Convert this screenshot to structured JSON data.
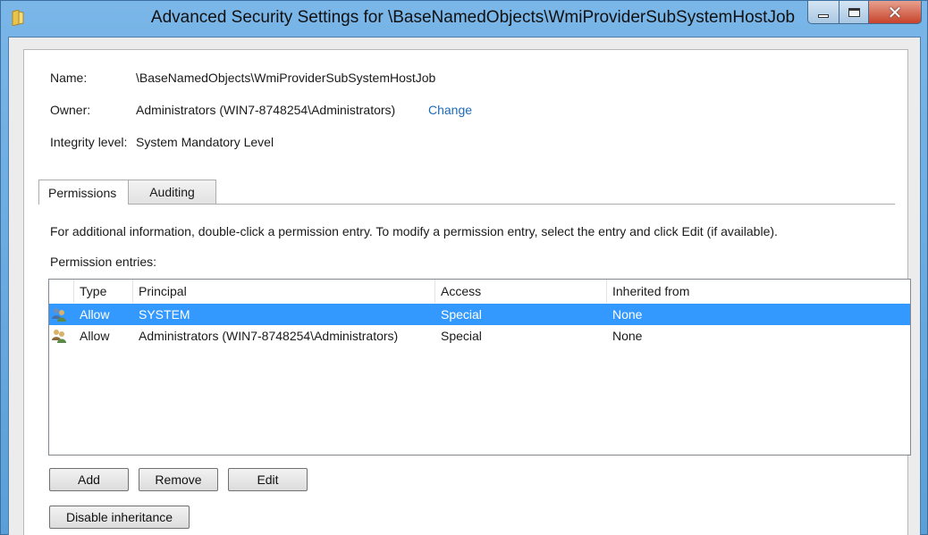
{
  "window": {
    "title": "Advanced Security Settings for \\BaseNamedObjects\\WmiProviderSubSystemHostJob"
  },
  "fields": {
    "name_label": "Name:",
    "name_value": "\\BaseNamedObjects\\WmiProviderSubSystemHostJob",
    "owner_label": "Owner:",
    "owner_value": "Administrators (WIN7-8748254\\Administrators)",
    "owner_change_link": "Change",
    "integrity_label": "Integrity level:",
    "integrity_value": "System Mandatory Level"
  },
  "tabs": [
    {
      "label": "Permissions",
      "active": true
    },
    {
      "label": "Auditing",
      "active": false
    }
  ],
  "permissions": {
    "info_text": "For additional information, double-click a permission entry. To modify a permission entry, select the entry and click Edit (if available).",
    "entries_label": "Permission entries:",
    "columns": [
      "Type",
      "Principal",
      "Access",
      "Inherited from"
    ],
    "rows": [
      {
        "icon": "user-group-icon",
        "type": "Allow",
        "principal": "SYSTEM",
        "access": "Special",
        "inherited_from": "None",
        "selected": true
      },
      {
        "icon": "user-group-icon",
        "type": "Allow",
        "principal": "Administrators (WIN7-8748254\\Administrators)",
        "access": "Special",
        "inherited_from": "None",
        "selected": false
      }
    ],
    "buttons": {
      "add": "Add",
      "remove": "Remove",
      "edit": "Edit",
      "disable_inheritance": "Disable inheritance"
    }
  },
  "colors": {
    "selection": "#3399ff",
    "link": "#1e6bb8",
    "frame": "#5fa3dc"
  }
}
